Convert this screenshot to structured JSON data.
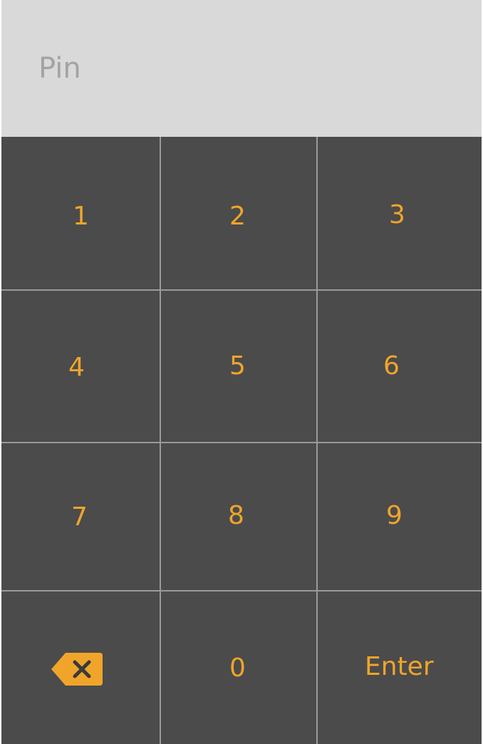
{
  "pin": {
    "placeholder": "Pin",
    "value": ""
  },
  "keypad": {
    "keys": [
      "1",
      "2",
      "3",
      "4",
      "5",
      "6",
      "7",
      "8",
      "9",
      "0"
    ],
    "enter_label": "Enter",
    "backspace_icon": "backspace-icon"
  },
  "colors": {
    "accent": "#f0a52a",
    "keypad_bg": "#4b4b4b",
    "display_bg": "#d9d9d9",
    "placeholder": "#a3a3a3",
    "divider": "#9a9a9a"
  }
}
